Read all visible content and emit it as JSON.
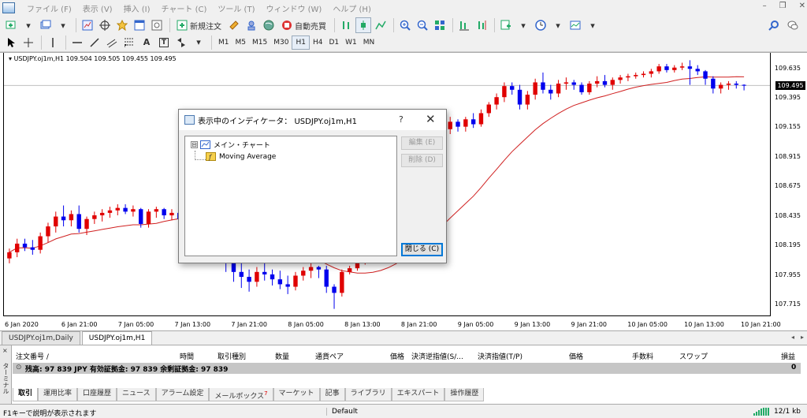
{
  "menu": [
    "ファイル (F)",
    "表示 (V)",
    "挿入 (I)",
    "チャート (C)",
    "ツール (T)",
    "ウィンドウ (W)",
    "ヘルプ (H)"
  ],
  "window_controls": [
    "–",
    "❐",
    "✕"
  ],
  "toolbar1": {
    "new_order": "新規注文",
    "auto_trading": "自動売買"
  },
  "toolbar2": {
    "text_tool": "A",
    "text_label_tool": "T",
    "timeframes": [
      "M1",
      "M5",
      "M15",
      "M30",
      "H1",
      "H4",
      "D1",
      "W1",
      "MN"
    ],
    "active_timeframe": "H1"
  },
  "chart": {
    "header": "USDJPY.oj1m,H1  109.504 109.505 109.455 109.495",
    "current_price": "109.495",
    "price_line_color": "#c0c0c0"
  },
  "chart_data": {
    "type": "candlestick",
    "title": "USDJPY.oj1m,H1",
    "ohlc_header": [
      109.504,
      109.505,
      109.455,
      109.495
    ],
    "y_ticks": [
      "109.635",
      "109.395",
      "109.155",
      "108.915",
      "108.675",
      "108.435",
      "108.195",
      "107.955",
      "107.715"
    ],
    "x_ticks": [
      "6 Jan 2020",
      "6 Jan 21:00",
      "7 Jan 05:00",
      "7 Jan 13:00",
      "7 Jan 21:00",
      "8 Jan 05:00",
      "8 Jan 13:00",
      "8 Jan 21:00",
      "9 Jan 05:00",
      "9 Jan 13:00",
      "9 Jan 21:00",
      "10 Jan 05:00",
      "10 Jan 13:00",
      "10 Jan 21:00"
    ],
    "ylim": [
      107.62,
      109.76
    ],
    "up_color": "#e00000",
    "down_color": "#0000ee",
    "ma_color": "#d02020",
    "indicator": "Moving Average",
    "candles": [
      [
        108.09,
        108.17,
        108.05,
        108.14
      ],
      [
        108.14,
        108.25,
        108.1,
        108.21
      ],
      [
        108.21,
        108.25,
        108.15,
        108.18
      ],
      [
        108.18,
        108.24,
        108.12,
        108.16
      ],
      [
        108.16,
        108.3,
        108.13,
        108.27
      ],
      [
        108.27,
        108.38,
        108.22,
        108.35
      ],
      [
        108.35,
        108.47,
        108.3,
        108.43
      ],
      [
        108.43,
        108.52,
        108.35,
        108.4
      ],
      [
        108.4,
        108.48,
        108.35,
        108.45
      ],
      [
        108.45,
        108.52,
        108.3,
        108.33
      ],
      [
        108.33,
        108.43,
        108.28,
        108.41
      ],
      [
        108.41,
        108.47,
        108.37,
        108.44
      ],
      [
        108.44,
        108.49,
        108.39,
        108.46
      ],
      [
        108.46,
        108.51,
        108.42,
        108.48
      ],
      [
        108.48,
        108.53,
        108.44,
        108.5
      ],
      [
        108.5,
        108.53,
        108.45,
        108.47
      ],
      [
        108.47,
        108.52,
        108.43,
        108.49
      ],
      [
        108.49,
        108.5,
        108.34,
        108.37
      ],
      [
        108.37,
        108.49,
        108.34,
        108.47
      ],
      [
        108.47,
        108.51,
        108.42,
        108.49
      ],
      [
        108.49,
        108.5,
        108.41,
        108.44
      ],
      [
        108.44,
        108.49,
        108.4,
        108.46
      ],
      [
        108.46,
        108.49,
        108.38,
        108.41
      ],
      [
        108.41,
        108.48,
        108.38,
        108.45
      ],
      [
        108.45,
        108.47,
        108.15,
        108.22
      ],
      [
        108.22,
        108.3,
        108.12,
        108.25
      ],
      [
        108.25,
        108.28,
        108.1,
        108.16
      ],
      [
        108.16,
        108.22,
        108.05,
        108.1
      ],
      [
        108.1,
        108.15,
        107.98,
        108.05
      ],
      [
        108.05,
        108.12,
        107.9,
        107.98
      ],
      [
        107.98,
        108.05,
        107.85,
        107.94
      ],
      [
        107.94,
        108.0,
        107.82,
        107.9
      ],
      [
        107.9,
        108.02,
        107.86,
        107.98
      ],
      [
        107.98,
        108.05,
        107.91,
        107.96
      ],
      [
        107.96,
        108.0,
        107.87,
        107.92
      ],
      [
        107.92,
        107.99,
        107.84,
        107.88
      ],
      [
        107.88,
        107.95,
        107.8,
        107.86
      ],
      [
        107.86,
        107.98,
        107.83,
        107.95
      ],
      [
        107.95,
        108.02,
        107.91,
        107.99
      ],
      [
        107.99,
        108.05,
        107.93,
        108.02
      ],
      [
        108.02,
        108.03,
        107.93,
        108.0
      ],
      [
        108.0,
        108.03,
        107.81,
        107.86
      ],
      [
        107.86,
        107.88,
        107.68,
        107.81
      ],
      [
        107.81,
        108.0,
        107.78,
        107.98
      ],
      [
        107.98,
        108.03,
        107.96,
        108.01
      ],
      [
        108.01,
        108.1,
        107.99,
        108.07
      ],
      [
        108.07,
        108.18,
        108.04,
        108.15
      ],
      [
        108.15,
        108.28,
        108.11,
        108.24
      ],
      [
        108.24,
        108.37,
        108.2,
        108.33
      ],
      [
        108.33,
        108.48,
        108.3,
        108.45
      ],
      [
        108.45,
        108.62,
        108.41,
        108.58
      ],
      [
        108.58,
        108.75,
        108.54,
        108.71
      ],
      [
        108.71,
        108.86,
        108.67,
        108.82
      ],
      [
        108.82,
        108.95,
        108.78,
        108.91
      ],
      [
        108.91,
        109.05,
        108.87,
        109.01
      ],
      [
        109.01,
        109.12,
        108.97,
        109.08
      ],
      [
        109.08,
        109.18,
        109.03,
        109.14
      ],
      [
        109.14,
        109.24,
        109.1,
        109.2
      ],
      [
        109.2,
        109.22,
        109.12,
        109.16
      ],
      [
        109.16,
        109.24,
        109.12,
        109.22
      ],
      [
        109.22,
        109.27,
        109.15,
        109.18
      ],
      [
        109.18,
        109.3,
        109.16,
        109.27
      ],
      [
        109.27,
        109.36,
        109.24,
        109.34
      ],
      [
        109.34,
        109.43,
        109.3,
        109.4
      ],
      [
        109.4,
        109.52,
        109.36,
        109.49
      ],
      [
        109.49,
        109.52,
        109.42,
        109.46
      ],
      [
        109.46,
        109.5,
        109.3,
        109.34
      ],
      [
        109.34,
        109.45,
        109.3,
        109.42
      ],
      [
        109.42,
        109.55,
        109.38,
        109.52
      ],
      [
        109.52,
        109.6,
        109.43,
        109.46
      ],
      [
        109.46,
        109.5,
        109.38,
        109.43
      ],
      [
        109.43,
        109.54,
        109.4,
        109.51
      ],
      [
        109.51,
        109.56,
        109.46,
        109.52
      ],
      [
        109.52,
        109.54,
        109.46,
        109.5
      ],
      [
        109.5,
        109.52,
        109.42,
        109.44
      ],
      [
        109.44,
        109.53,
        109.42,
        109.51
      ],
      [
        109.51,
        109.57,
        109.48,
        109.53
      ],
      [
        109.53,
        109.58,
        109.48,
        109.5
      ],
      [
        109.5,
        109.56,
        109.46,
        109.54
      ],
      [
        109.54,
        109.58,
        109.51,
        109.56
      ],
      [
        109.56,
        109.59,
        109.53,
        109.57
      ],
      [
        109.57,
        109.6,
        109.55,
        109.58
      ],
      [
        109.58,
        109.61,
        109.56,
        109.59
      ],
      [
        109.59,
        109.63,
        109.56,
        109.61
      ],
      [
        109.61,
        109.67,
        109.59,
        109.65
      ],
      [
        109.65,
        109.67,
        109.6,
        109.62
      ],
      [
        109.62,
        109.66,
        109.6,
        109.64
      ],
      [
        109.64,
        109.68,
        109.62,
        109.65
      ],
      [
        109.65,
        109.7,
        109.5,
        109.63
      ],
      [
        109.63,
        109.66,
        109.58,
        109.61
      ],
      [
        109.61,
        109.62,
        109.5,
        109.55
      ],
      [
        109.55,
        109.57,
        109.43,
        109.47
      ],
      [
        109.47,
        109.52,
        109.43,
        109.5
      ],
      [
        109.5,
        109.53,
        109.46,
        109.51
      ],
      [
        109.51,
        109.53,
        109.47,
        109.5
      ],
      [
        109.5,
        109.505,
        109.455,
        109.495
      ]
    ]
  },
  "chart_tabs": [
    "USDJPY.oj1m,Daily",
    "USDJPY.oj1m,H1"
  ],
  "active_chart_tab": "USDJPY.oj1m,H1",
  "terminal": {
    "side_label": "ターミナル",
    "close_glyph": "×",
    "columns": [
      "注文番号 /",
      "時間",
      "取引種別",
      "数量",
      "通貨ペア",
      "価格",
      "決済逆指値(S/...",
      "決済指値(T/P)",
      "価格",
      "手数料",
      "スワップ",
      "損益"
    ],
    "balance_label": "残高: 97 839 JPY  有効証拠金: 97 839  余剰証拠金: 97 839",
    "balance_value": "0",
    "tabs": [
      "取引",
      "運用比率",
      "口座履歴",
      "ニュース",
      "アラーム設定",
      "メールボックス",
      "マーケット",
      "記事",
      "ライブラリ",
      "エキスパート",
      "操作履歴"
    ],
    "mailbox_badge": "7",
    "active_tab": "取引"
  },
  "status": {
    "help": "F1キーで説明が表示されます",
    "profile": "Default",
    "connection": "12/1 kb"
  },
  "dialog": {
    "title": "表示中のインディケータ： USDJPY.oj1m,H1",
    "help_glyph": "?",
    "close_glyph": "✕",
    "tree_root": "メイン・チャート",
    "tree_child": "Moving Average",
    "expander_glyph": "⊟",
    "edit_button": "編集 (E)",
    "delete_button": "削除 (D)",
    "close_button": "閉じる (C)"
  }
}
